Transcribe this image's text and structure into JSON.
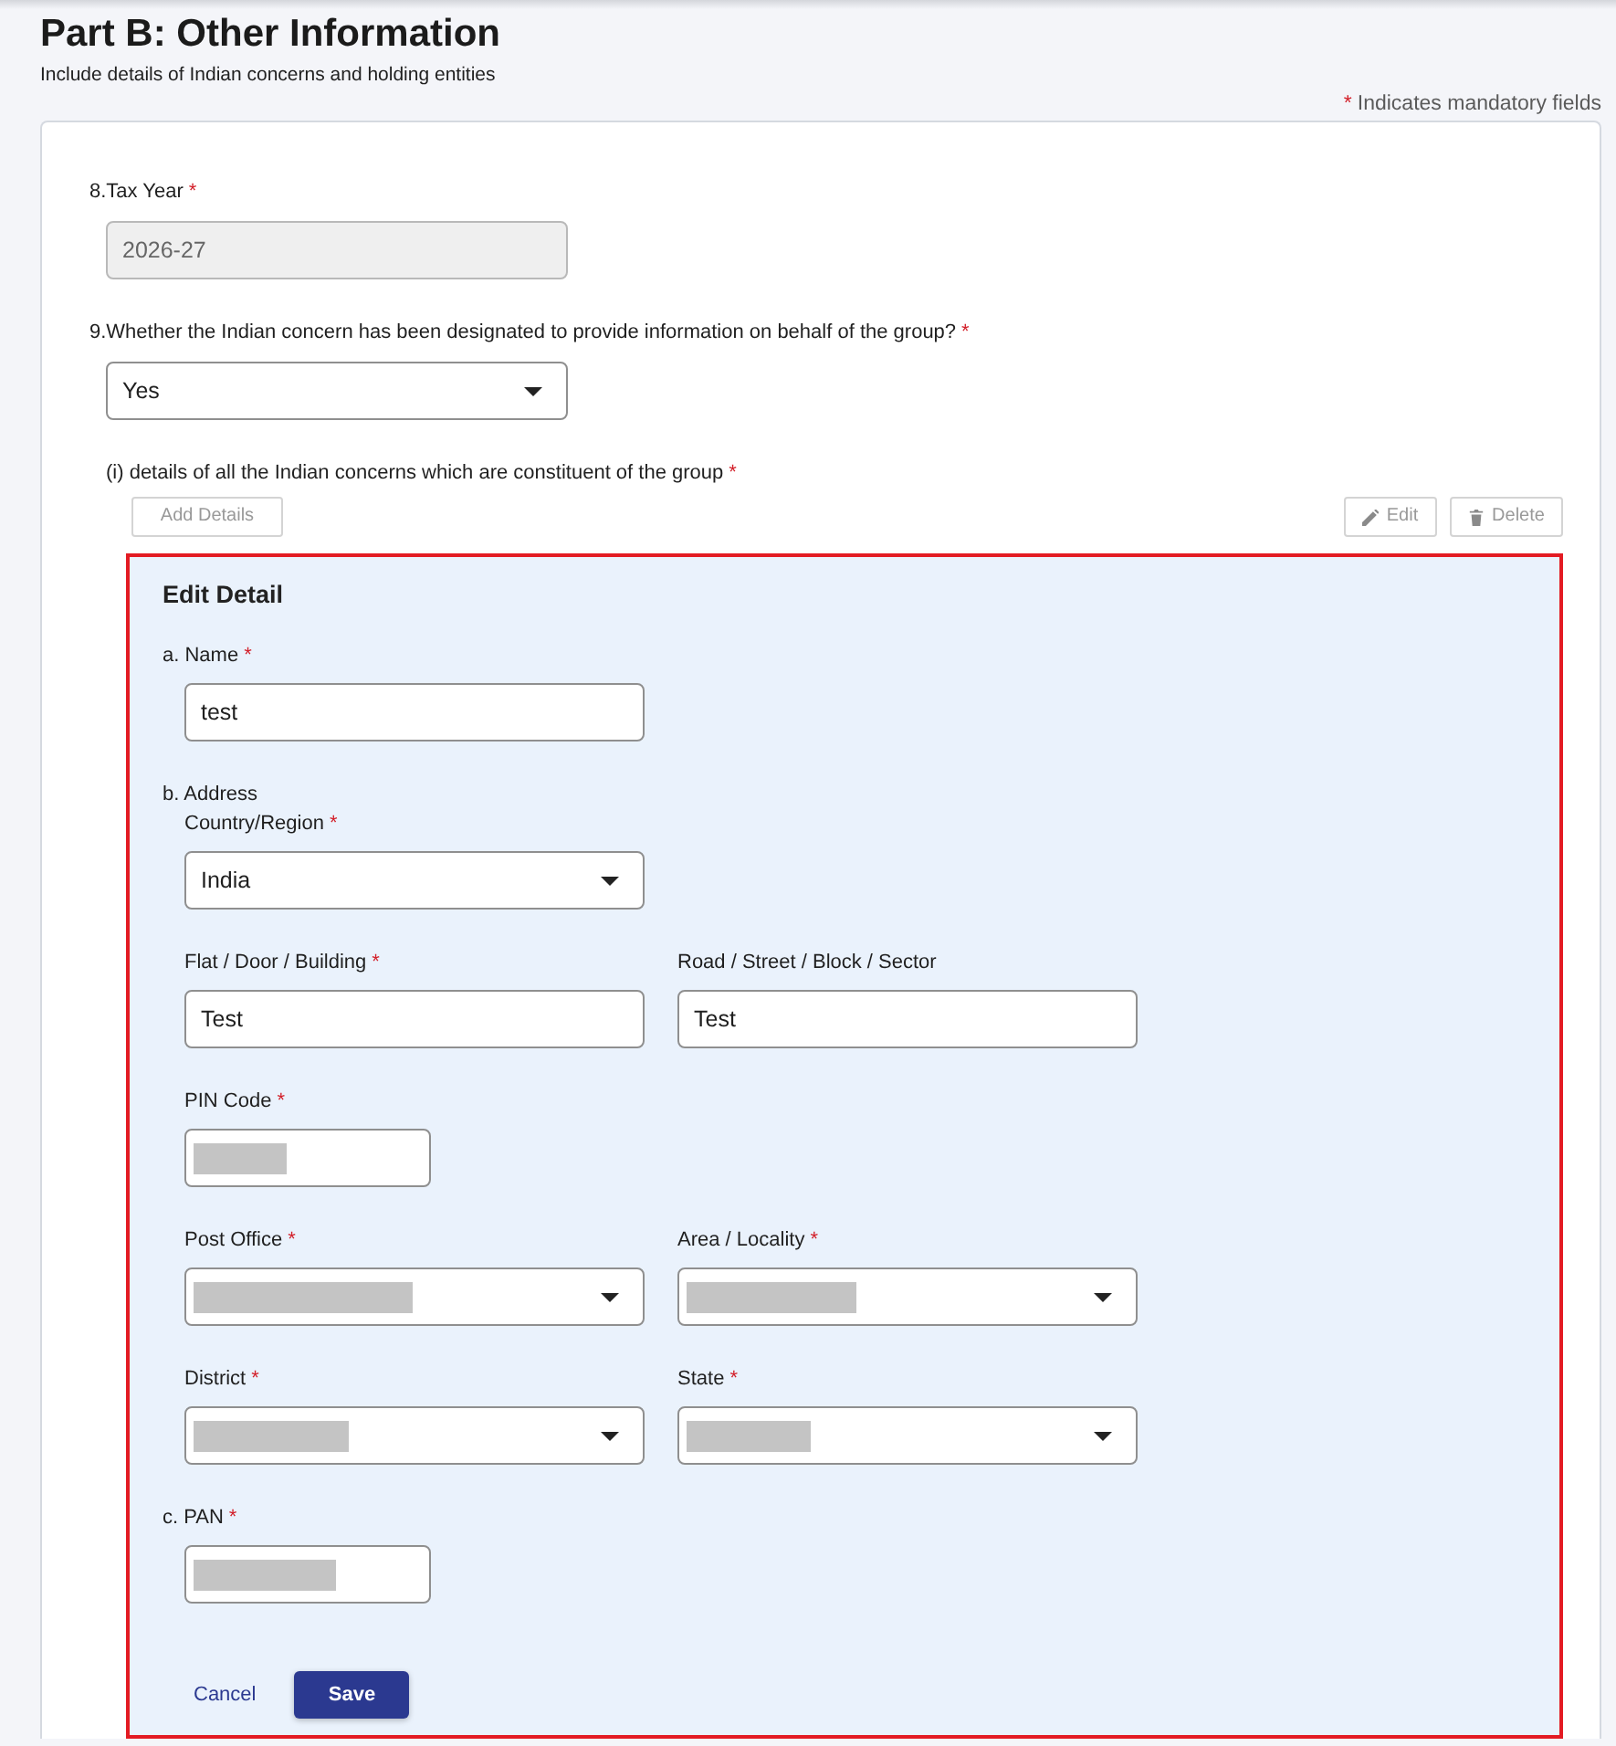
{
  "header": {
    "title": "Part B: Other Information",
    "subtitle": "Include details of Indian concerns and holding entities",
    "legend": {
      "mark": "*",
      "text": "Indicates mandatory fields"
    }
  },
  "questions": [
    {
      "label": "8.Tax Year",
      "mark": "*",
      "kind": "input",
      "value": "2026-27",
      "disabled": true
    },
    {
      "label": "9.Whether the Indian concern has been designated to provide information on behalf of the group?",
      "mark": "*",
      "kind": "select",
      "value": "Yes",
      "disabled": false
    }
  ],
  "concerns": {
    "label": "(i) details of all the Indian concerns which are constituent of the group",
    "mark": "*",
    "buttons": [
      {
        "kind": "add",
        "label": "Add Details",
        "disabled": true
      },
      {
        "kind": "edit",
        "label": "Edit",
        "disabled": true
      },
      {
        "kind": "delete",
        "label": "Delete",
        "disabled": true
      }
    ]
  },
  "edit_detail": {
    "title": "Edit Detail",
    "highlighted": true,
    "sections": [
      {
        "label": "a. Name",
        "mark": "*",
        "rows": [
          [
            {
              "kind": "input",
              "value": "test",
              "redacted": false
            }
          ]
        ]
      },
      {
        "label": "b. Address",
        "rows": [
          [
            {
              "label": "Country/Region",
              "mark": "*",
              "kind": "select",
              "value": "India",
              "redacted": false
            }
          ],
          [
            {
              "label": "Flat / Door / Building",
              "mark": "*",
              "kind": "input",
              "value": "Test",
              "redacted": false
            },
            {
              "label": "Road / Street / Block / Sector",
              "kind": "input",
              "value": "Test",
              "redacted": false
            }
          ],
          [
            {
              "label": "PIN Code",
              "mark": "*",
              "kind": "code",
              "redacted": true
            }
          ],
          [
            {
              "label": "Post Office",
              "mark": "*",
              "kind": "select",
              "redacted": true
            },
            {
              "label": "Area / Locality",
              "mark": "*",
              "kind": "select",
              "redacted": true
            }
          ],
          [
            {
              "label": "District",
              "mark": "*",
              "kind": "select",
              "redacted": true
            },
            {
              "label": "State",
              "mark": "*",
              "kind": "select",
              "redacted": true
            }
          ]
        ]
      },
      {
        "label": "c. PAN",
        "mark": "*",
        "rows": [
          [
            {
              "kind": "code",
              "redacted": true
            }
          ]
        ]
      }
    ],
    "actions": [
      {
        "kind": "link",
        "label": "Cancel"
      },
      {
        "kind": "primary",
        "label": "Save"
      }
    ]
  }
}
